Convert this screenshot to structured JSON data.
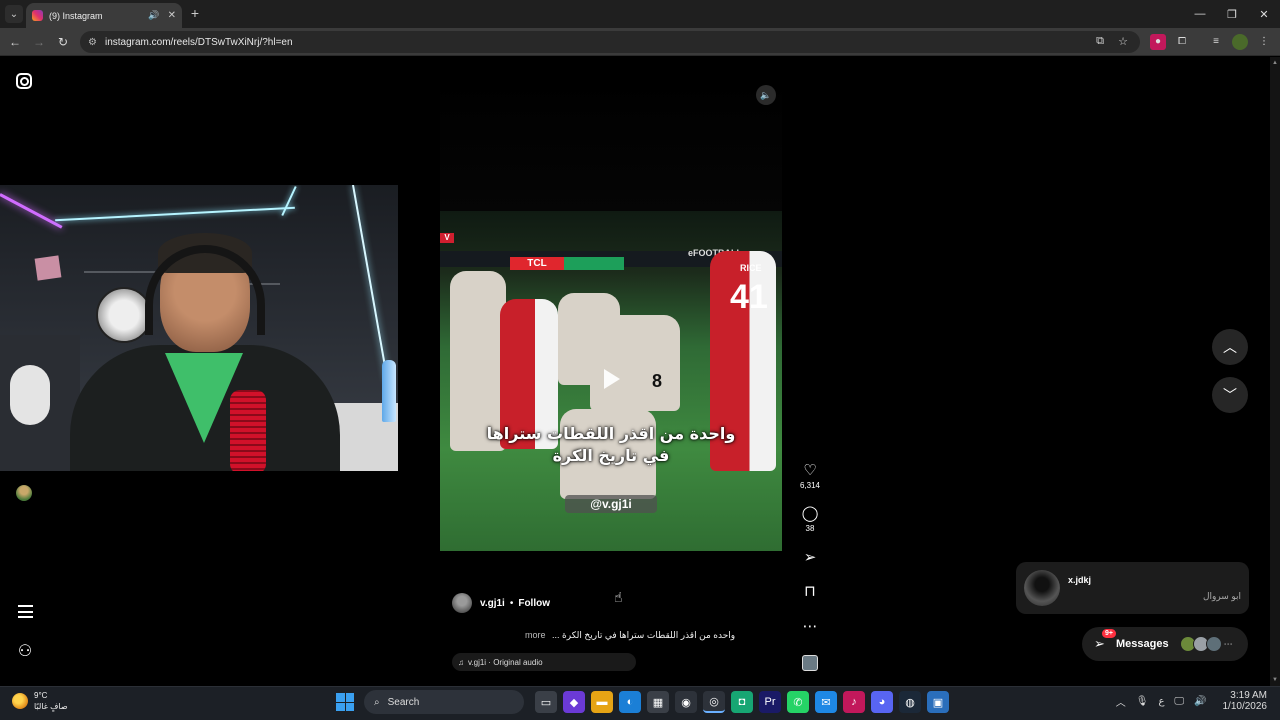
{
  "browser": {
    "tab_title": "(9) Instagram",
    "tab_audio_icon": "speaker-icon",
    "tab_close": "✕",
    "new_tab": "+",
    "url": "instagram.com/reels/DTSwTwXiNrj/?hl=en",
    "window_controls": [
      "—",
      "❐",
      "✕"
    ]
  },
  "reel": {
    "video_caption": "واحدة من اقذر اللقطات ستراها في تاريخ الكرة",
    "watermark": "@v.gj1i",
    "banner_brand": "TCL",
    "banner_right": "eFOOTBALL",
    "player_number": "41",
    "player_name": "RICE",
    "player_number_2": "8",
    "author": "v.gj1i",
    "follow_label": "Follow",
    "caption": "واحده من اقذر اللقطات ستراها في تاريخ الكرة ...",
    "caption_more": "more",
    "audio": "v.gj1i · Original audio",
    "likes": "6,314",
    "comments": "38"
  },
  "messages": {
    "preview_user": "x.jdkj",
    "preview_text": "ابو سروال",
    "label": "Messages",
    "badge": "9+"
  },
  "taskbar": {
    "temperature": "9°C",
    "weather": "صافٍ غالبًا",
    "search": "Search",
    "lang": "ع",
    "time": "3:19 AM",
    "date": "1/10/2026"
  },
  "colors": {
    "accent_red": "#ff3040",
    "background": "#000000",
    "chrome_dark": "#1f1f1f"
  }
}
